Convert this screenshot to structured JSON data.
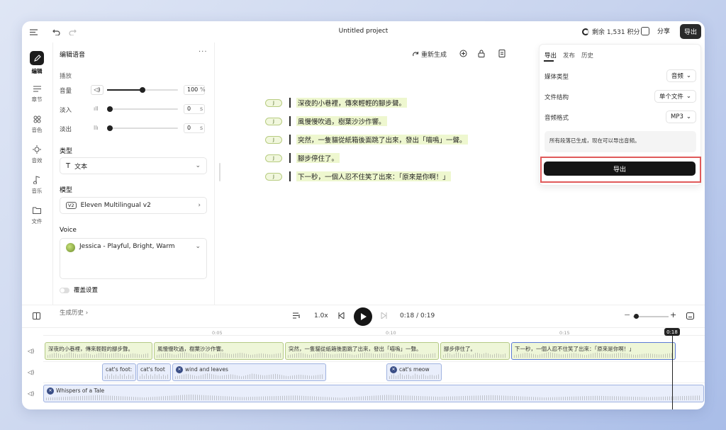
{
  "topbar": {
    "title": "Untitled project",
    "credits": "剩余 1,531 积分",
    "share": "分享",
    "export": "导出"
  },
  "rail": [
    {
      "label": "编辑",
      "icon": "edit-icon",
      "active": true
    },
    {
      "label": "章节",
      "icon": "chapters-icon"
    },
    {
      "label": "音色",
      "icon": "voices-icon"
    },
    {
      "label": "音效",
      "icon": "sfx-icon"
    },
    {
      "label": "音乐",
      "icon": "music-icon"
    },
    {
      "label": "文件",
      "icon": "files-icon"
    }
  ],
  "panel": {
    "header": "编辑语音",
    "playback_label": "播放",
    "volume": {
      "label": "音量",
      "value": "100",
      "unit": "%",
      "level": 0.5
    },
    "fade_in": {
      "label": "淡入",
      "value": "0",
      "unit": "s",
      "level": 0
    },
    "fade_out": {
      "label": "淡出",
      "value": "0",
      "unit": "s",
      "level": 0
    },
    "type_label": "类型",
    "type_value": "文本",
    "model_label": "模型",
    "model_badge": "V2",
    "model_value": "Eleven Multilingual v2",
    "voice_label": "Voice",
    "voice_value": "Jessica - Playful, Bright, Warm",
    "override_label": "覆盖设置",
    "history_label": "生成历史"
  },
  "editor": {
    "regenerate": "重新生成",
    "chip_label": "J",
    "lines": [
      "深夜的小巷裡，傳來輕輕的腳步聲。",
      "風慢慢吹過，樹葉沙沙作響。",
      "突然，一隻貓從紙箱後面跳了出來，發出「喵嗚」一聲。",
      "腳步停住了。",
      "下一秒，一個人忍不住笑了出來：「原來是你啊！」"
    ]
  },
  "export_panel": {
    "tabs": [
      "导出",
      "发布",
      "历史"
    ],
    "media_type_label": "媒体类型",
    "media_type_value": "音频",
    "structure_label": "文件结构",
    "structure_value": "单个文件",
    "format_label": "音频格式",
    "format_value": "MP3",
    "note": "所有段落已生成，现在可以导出音频。",
    "button": "导出"
  },
  "playback": {
    "speed": "1.0x",
    "time": "0:18 / 0:19",
    "playhead": "0:18"
  },
  "ruler": [
    "0:05",
    "0:10",
    "0:15"
  ],
  "timeline": {
    "speech_clips": [
      "深夜的小巷裡，傳來輕輕的腳步聲。",
      "風慢慢吹過，樹葉沙沙作響。",
      "突然，一隻貓從紙箱後面跳了出來，發出「喵嗚」一聲。",
      "腳步停住了。",
      "下一秒，一個人忍不住笑了出來：「原來是你啊！」"
    ],
    "sfx_clips": [
      "cat's foot:",
      "cat's foot",
      "wind and leaves",
      "cat's meow"
    ],
    "music_clip": "Whispers of a Tale"
  }
}
